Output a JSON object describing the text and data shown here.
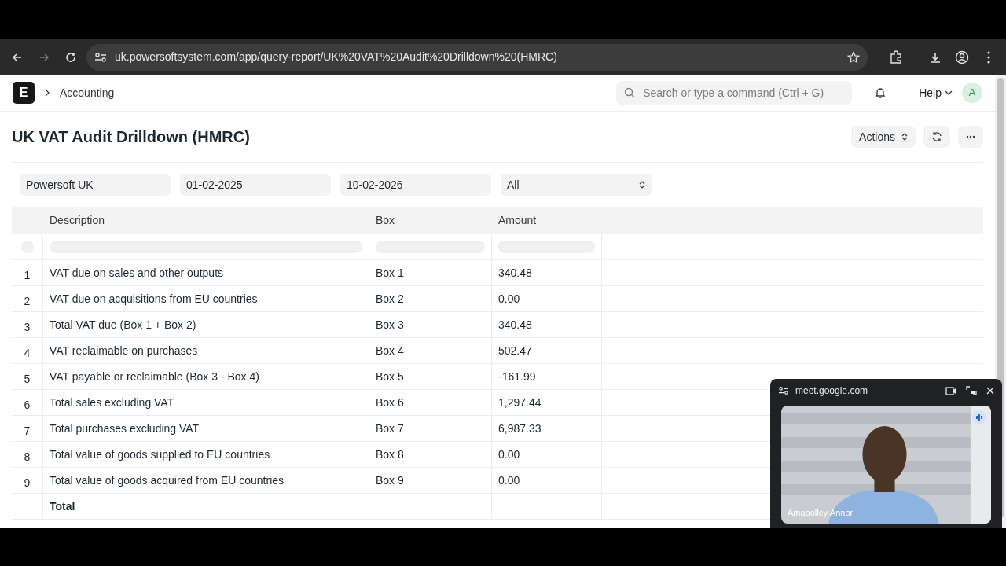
{
  "browser": {
    "url": "uk.powersoftsystem.com/app/query-report/UK%20VAT%20Audit%20Drilldown%20(HMRC)"
  },
  "navbar": {
    "logo": "E",
    "breadcrumb": "Accounting",
    "search_placeholder": "Search or type a command (Ctrl + G)",
    "help": "Help",
    "avatar": "A"
  },
  "page": {
    "title": "UK VAT Audit Drilldown (HMRC)",
    "actions": "Actions"
  },
  "filters": [
    {
      "kind": "text",
      "value": "Powersoft UK"
    },
    {
      "kind": "text",
      "value": "01-02-2025"
    },
    {
      "kind": "text",
      "value": "10-02-2026"
    },
    {
      "kind": "select",
      "value": "All"
    }
  ],
  "table": {
    "columns": [
      "Description",
      "Box",
      "Amount"
    ],
    "rows": [
      {
        "index": "1",
        "description": "VAT due on sales and other outputs",
        "box": "Box 1",
        "amount": "340.48"
      },
      {
        "index": "2",
        "description": "VAT due on acquisitions from EU countries",
        "box": "Box 2",
        "amount": "0.00"
      },
      {
        "index": "3",
        "description": "Total VAT due (Box 1 + Box 2)",
        "box": "Box 3",
        "amount": "340.48"
      },
      {
        "index": "4",
        "description": "VAT reclaimable on purchases",
        "box": "Box 4",
        "amount": "502.47"
      },
      {
        "index": "5",
        "description": "VAT payable or reclaimable (Box 3 - Box 4)",
        "box": "Box 5",
        "amount": "-161.99"
      },
      {
        "index": "6",
        "description": "Total sales excluding VAT",
        "box": "Box 6",
        "amount": "1,297.44"
      },
      {
        "index": "7",
        "description": "Total purchases excluding VAT",
        "box": "Box 7",
        "amount": "6,987.33"
      },
      {
        "index": "8",
        "description": "Total value of goods supplied to EU countries",
        "box": "Box 8",
        "amount": "0.00"
      },
      {
        "index": "9",
        "description": "Total value of goods acquired from EU countries",
        "box": "Box 9",
        "amount": "0.00"
      }
    ],
    "total_label": "Total"
  },
  "pip": {
    "title": "meet.google.com",
    "caption": "Amapolley Annor",
    "speaking": true
  }
}
